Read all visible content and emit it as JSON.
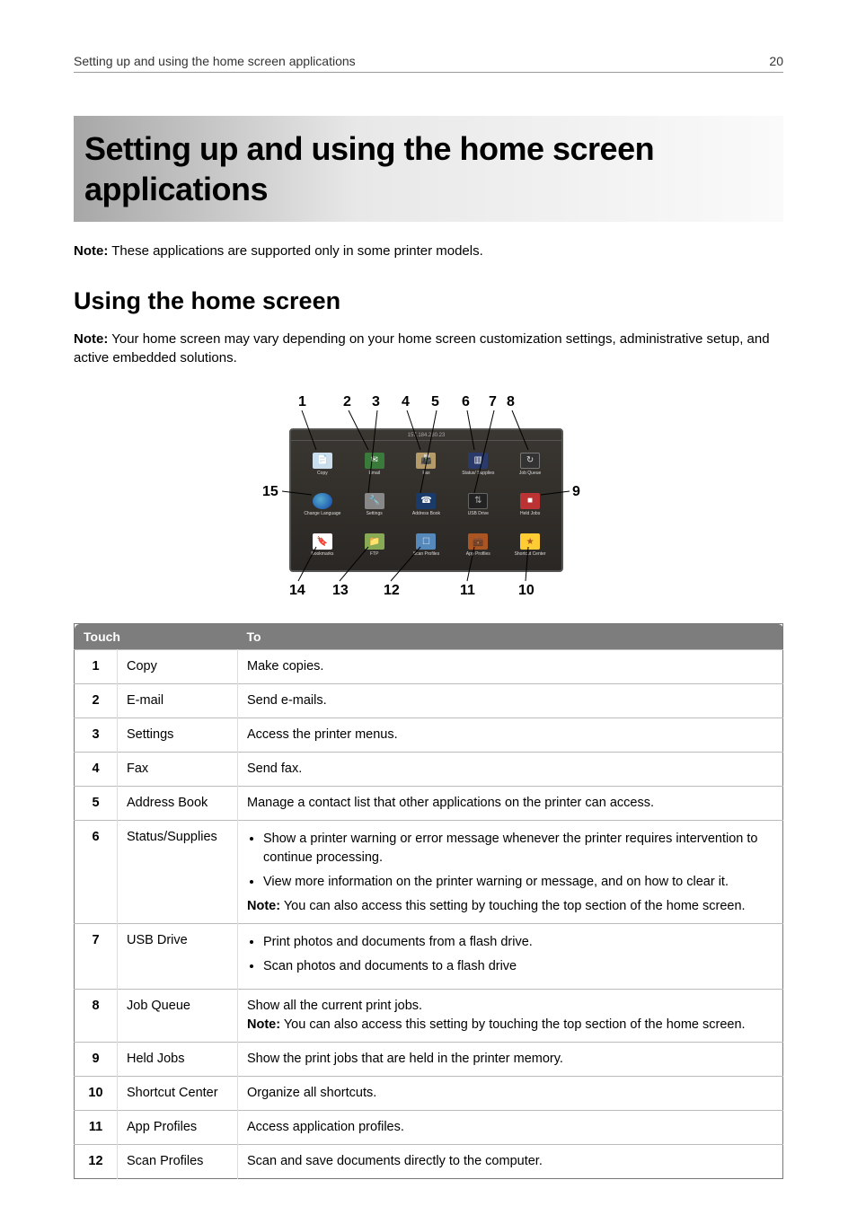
{
  "header": {
    "running_title": "Setting up and using the home screen applications",
    "page_number": "20"
  },
  "banner_title": "Setting up and using the home screen applications",
  "note1_label": "Note:",
  "note1_text": " These applications are supported only in some printer models.",
  "h2": "Using the home screen",
  "note2_label": "Note:",
  "note2_text": " Your home screen may vary depending on your home screen customization settings, administrative setup, and active embedded solutions.",
  "figure": {
    "screen_time": "157.184.230.23",
    "top_callouts": {
      "c1": "1",
      "c2": "2",
      "c3": "3",
      "c4": "4",
      "c5": "5",
      "c6": "6",
      "c7": "7",
      "c8": "8"
    },
    "side_callouts": {
      "c9": "9",
      "c15": "15"
    },
    "bottom_callouts": {
      "c10": "10",
      "c11": "11",
      "c12": "12",
      "c13": "13",
      "c14": "14"
    },
    "icons": {
      "copy": "Copy",
      "email": "Email",
      "fax": "Fax",
      "status": "Status/\nSupplies",
      "queue": "Job\nQueue",
      "lang": "Change\nLanguage",
      "settings": "Settings",
      "abook": "Address\nBook",
      "usb": "USB\nDrive",
      "held": "Held Jobs",
      "bkmk": "Bookmarks",
      "ftp": "FTP",
      "scan": "Scan Profiles",
      "app": "App Profiles",
      "star": "Shortcut Center"
    }
  },
  "table": {
    "head_touch": "Touch",
    "head_to": "To",
    "rows": [
      {
        "n": "1",
        "name": "Copy",
        "desc": "Make copies."
      },
      {
        "n": "2",
        "name": "E-mail",
        "desc": "Send e-mails."
      },
      {
        "n": "3",
        "name": "Settings",
        "desc": "Access the printer menus."
      },
      {
        "n": "4",
        "name": "Fax",
        "desc": "Send fax."
      },
      {
        "n": "5",
        "name": "Address Book",
        "desc": "Manage a contact list that other applications on the printer can access."
      },
      {
        "n": "6",
        "name": "Status/Supplies",
        "bullets": [
          "Show a printer warning or error message whenever the printer requires intervention to continue processing.",
          "View more information on the printer warning or message, and on how to clear it."
        ],
        "note_label": "Note:",
        "note_text": " You can also access this setting by touching the top section of the home screen."
      },
      {
        "n": "7",
        "name": "USB Drive",
        "bullets": [
          "Print photos and documents from a flash drive.",
          "Scan photos and documents to a flash drive"
        ]
      },
      {
        "n": "8",
        "name": "Job Queue",
        "desc": "Show all the current print jobs.",
        "note_label": "Note:",
        "note_text": " You can also access this setting by touching the top section of the home screen."
      },
      {
        "n": "9",
        "name": "Held Jobs",
        "desc": "Show the print jobs that are held in the printer memory."
      },
      {
        "n": "10",
        "name": "Shortcut Center",
        "desc": "Organize all shortcuts."
      },
      {
        "n": "11",
        "name": "App Profiles",
        "desc": "Access application profiles."
      },
      {
        "n": "12",
        "name": "Scan Profiles",
        "desc": "Scan and save documents directly to the computer."
      }
    ]
  }
}
